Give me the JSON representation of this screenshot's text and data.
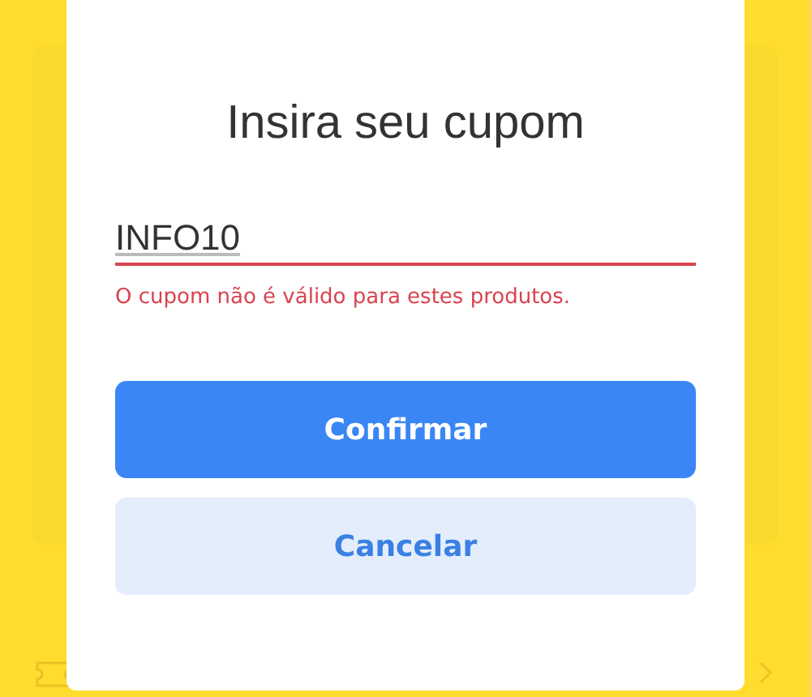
{
  "dialog": {
    "title": "Insira seu cupom",
    "coupon_field": {
      "value": "INFO10",
      "invalid": true
    },
    "error_message": "O cupom não é válido para estes produtos.",
    "buttons": [
      {
        "label": "Confirmar",
        "kind": "primary"
      },
      {
        "label": "Cancelar",
        "kind": "secondary"
      }
    ]
  }
}
